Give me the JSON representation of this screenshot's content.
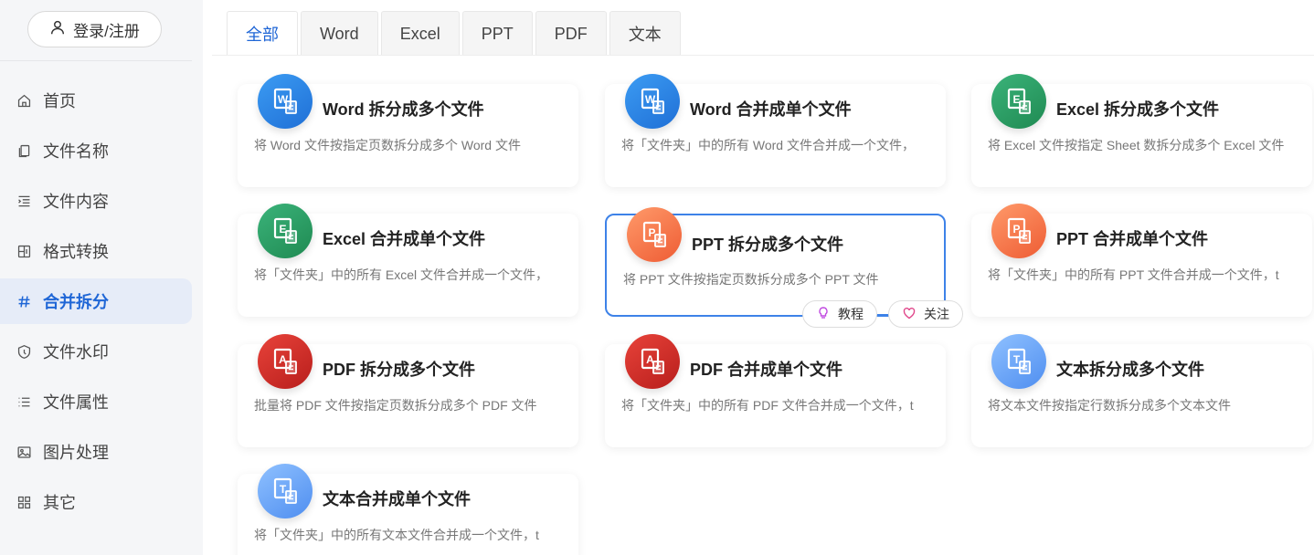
{
  "sidebar": {
    "login_label": "登录/注册",
    "items": [
      {
        "label": "首页",
        "icon": "home-icon"
      },
      {
        "label": "文件名称",
        "icon": "file-copy-icon"
      },
      {
        "label": "文件内容",
        "icon": "content-list-icon"
      },
      {
        "label": "格式转换",
        "icon": "grid-convert-icon"
      },
      {
        "label": "合并拆分",
        "icon": "hash-icon",
        "active": true
      },
      {
        "label": "文件水印",
        "icon": "shield-icon"
      },
      {
        "label": "文件属性",
        "icon": "list-icon"
      },
      {
        "label": "图片处理",
        "icon": "image-icon"
      },
      {
        "label": "其它",
        "icon": "apps-icon"
      }
    ]
  },
  "tabs": [
    {
      "label": "全部",
      "active": true
    },
    {
      "label": "Word"
    },
    {
      "label": "Excel"
    },
    {
      "label": "PPT"
    },
    {
      "label": "PDF"
    },
    {
      "label": "文本"
    }
  ],
  "cards": [
    {
      "title": "Word 拆分成多个文件",
      "desc": "将 Word 文件按指定页数拆分成多个 Word 文件",
      "color": "blue",
      "letter": "W"
    },
    {
      "title": "Word 合并成单个文件",
      "desc": "将「文件夹」中的所有 Word 文件合并成一个文件，",
      "color": "blue",
      "letter": "W"
    },
    {
      "title": "Excel 拆分成多个文件",
      "desc": "将 Excel 文件按指定 Sheet 数拆分成多个 Excel 文件",
      "color": "green",
      "letter": "E"
    },
    {
      "title": "Excel 合并成单个文件",
      "desc": "将「文件夹」中的所有 Excel 文件合并成一个文件，",
      "color": "green",
      "letter": "E"
    },
    {
      "title": "PPT 拆分成多个文件",
      "desc": "将 PPT 文件按指定页数拆分成多个 PPT 文件",
      "color": "orange",
      "letter": "P"
    },
    {
      "title": "PPT 合并成单个文件",
      "desc": "将「文件夹」中的所有 PPT 文件合并成一个文件，t",
      "color": "orange",
      "letter": "P"
    },
    {
      "title": "PDF 拆分成多个文件",
      "desc": "批量将 PDF 文件按指定页数拆分成多个 PDF 文件",
      "color": "red",
      "letter": "A"
    },
    {
      "title": "PDF 合并成单个文件",
      "desc": "将「文件夹」中的所有 PDF 文件合并成一个文件，t",
      "color": "red",
      "letter": "A"
    },
    {
      "title": "文本拆分成多个文件",
      "desc": "将文本文件按指定行数拆分成多个文本文件",
      "color": "lightblue",
      "letter": "T"
    },
    {
      "title": "文本合并成单个文件",
      "desc": "将「文件夹」中的所有文本文件合并成一个文件，t",
      "color": "lightblue",
      "letter": "T"
    }
  ],
  "hover_actions": {
    "tutorial_label": "教程",
    "follow_label": "关注"
  },
  "colors": {
    "accent": "#1f66d6",
    "hover_border": "#3d82e8",
    "follow_icon": "#e0468a",
    "tutorial_icon": "#c14be0"
  }
}
